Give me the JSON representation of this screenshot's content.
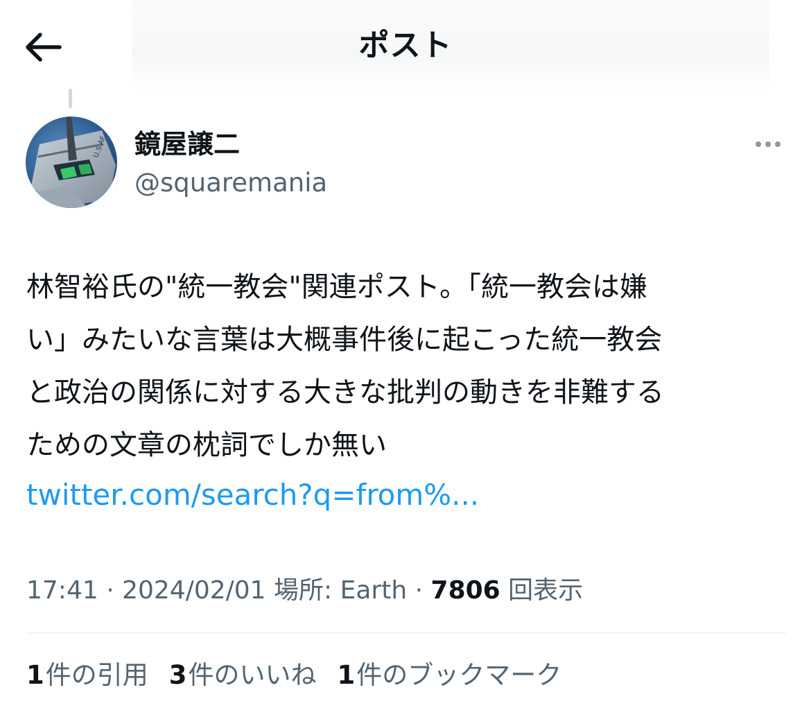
{
  "header": {
    "title": "ポスト",
    "back_icon": "arrow-left-icon"
  },
  "author": {
    "name": "鏡屋譲二",
    "handle": "@squaremania",
    "avatar_icon": "aircraft-avatar"
  },
  "more_icon": "ellipsis-icon",
  "tweet": {
    "lines": [
      "林智裕氏の\"統一教会\"関連ポスト。「統一教会は嫌",
      "い」みたいな言葉は大概事件後に起こった統一教会",
      "と政治の関係に対する大きな批判の動きを非難する",
      "ための文章の枕詞でしか無い"
    ],
    "link": "twitter.com/search?q=from%..."
  },
  "meta": {
    "time": "17:41",
    "separator": " · ",
    "date": "2024/02/01",
    "location": "場所: Earth",
    "views_count": "7806",
    "views_label": "回表示"
  },
  "stats": {
    "quotes_count": "1",
    "quotes_label": "件の引用",
    "likes_count": "3",
    "likes_label": "件のいいね",
    "bookmarks_count": "1",
    "bookmarks_label": "件のブックマーク"
  },
  "colors": {
    "accent": "#1d9bf0",
    "text": "#0f1419",
    "secondary": "#536471",
    "divider": "#eff3f4"
  }
}
